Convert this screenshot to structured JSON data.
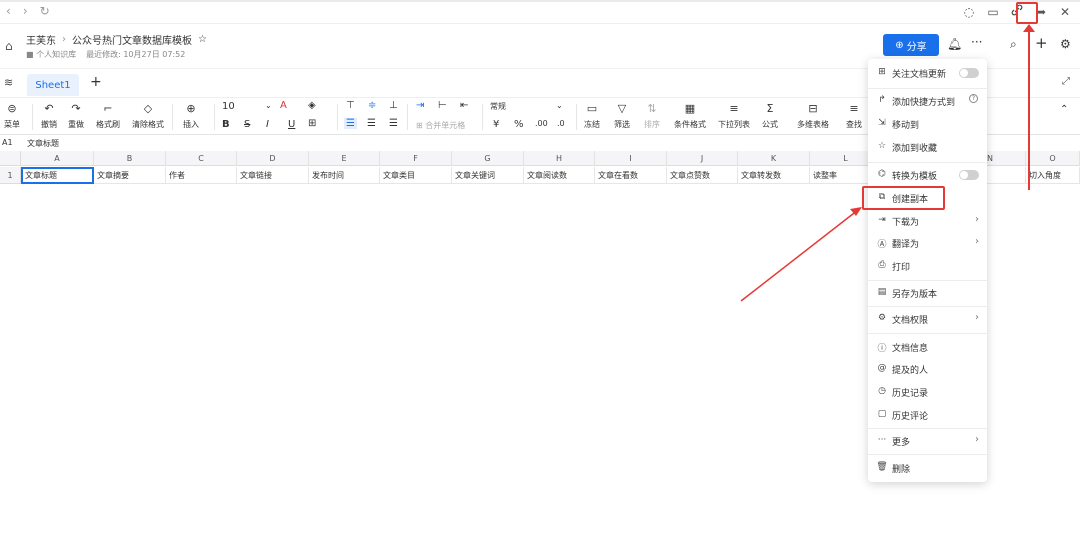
{
  "chrome": {
    "nav_back": "‹",
    "nav_forward": "›",
    "nav_refresh": "↻",
    "right_icons": [
      "comment-icon",
      "window-icon",
      "link-icon",
      "forward-icon",
      "close-icon"
    ]
  },
  "header": {
    "breadcrumb_owner": "王芙东",
    "breadcrumb_sep": "›",
    "doc_title": "公众号热门文章数据库模板",
    "star": "☆",
    "location": "个人知识库",
    "last_modified": "最近修改: 10月27日 07:52",
    "share_label": "分享",
    "more": "···"
  },
  "tabs": {
    "sheet_name": "Sheet1",
    "add": "+"
  },
  "toolbar": {
    "menu": "菜单",
    "undo": "撤销",
    "redo": "重做",
    "format_painter": "格式刷",
    "clear_format": "清除格式",
    "insert": "插入",
    "font_size": "10",
    "merge_cells": "合并单元格",
    "number_format": "常规",
    "currency": "¥",
    "percent": "%",
    "freeze": "冻结",
    "filter": "筛选",
    "sort": "排序",
    "conditional_format": "条件格式",
    "dropdown_list": "下拉列表",
    "formula": "公式",
    "multi_dim": "多维表格",
    "find": "查找"
  },
  "formula_bar": {
    "cell_ref": "A1",
    "value": "文章标题"
  },
  "grid": {
    "columns": [
      "A",
      "B",
      "C",
      "D",
      "E",
      "F",
      "G",
      "H",
      "I",
      "J",
      "K",
      "L",
      "N",
      "O"
    ],
    "row_number": "1",
    "row1": [
      "文章标题",
      "文章摘要",
      "作者",
      "文章链接",
      "发布时间",
      "文章类目",
      "文章关键词",
      "文章阅读数",
      "文章在看数",
      "文章点赞数",
      "文章转发数",
      "读整率",
      "",
      "切入角度"
    ]
  },
  "menu": {
    "items": [
      {
        "label": "关注文档更新",
        "icon": "follow-icon",
        "trail": "toggle"
      },
      {
        "label": "添加快捷方式到",
        "icon": "shortcut-icon",
        "trail": "help"
      },
      {
        "label": "移动到",
        "icon": "move-icon",
        "trail": ""
      },
      {
        "label": "添加到收藏",
        "icon": "star-icon",
        "trail": ""
      },
      {
        "label": "转换为模板",
        "icon": "template-icon",
        "trail": "toggle"
      },
      {
        "label": "创建副本",
        "icon": "copy-icon",
        "trail": ""
      },
      {
        "label": "下载为",
        "icon": "download-icon",
        "trail": "arrow"
      },
      {
        "label": "翻译为",
        "icon": "translate-icon",
        "trail": "arrow"
      },
      {
        "label": "打印",
        "icon": "print-icon",
        "trail": ""
      },
      {
        "label": "另存为版本",
        "icon": "save-version-icon",
        "trail": ""
      },
      {
        "label": "文档权限",
        "icon": "permission-icon",
        "trail": "arrow"
      },
      {
        "label": "文档信息",
        "icon": "info-icon",
        "trail": ""
      },
      {
        "label": "提及的人",
        "icon": "mention-icon",
        "trail": ""
      },
      {
        "label": "历史记录",
        "icon": "history-icon",
        "trail": ""
      },
      {
        "label": "历史评论",
        "icon": "comment-history-icon",
        "trail": ""
      },
      {
        "label": "更多",
        "icon": "more-icon",
        "trail": "arrow"
      },
      {
        "label": "删除",
        "icon": "delete-icon",
        "trail": ""
      }
    ]
  },
  "colors": {
    "accent": "#1a6fea",
    "annotation_red": "#e53935"
  }
}
